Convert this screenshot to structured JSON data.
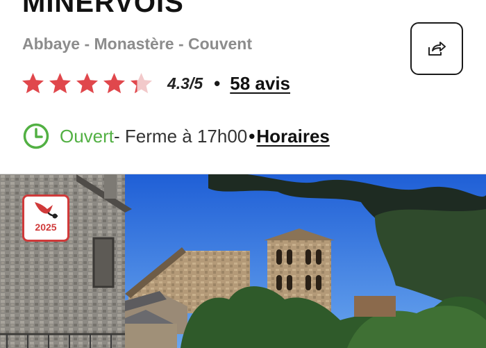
{
  "place": {
    "title": "MINERVOIS",
    "category": "Abbaye - Monastère - Couvent"
  },
  "share": {
    "icon": "share-icon"
  },
  "rating": {
    "stars": 4.3,
    "value_label": "4.3/5",
    "separator": "•",
    "reviews_label": "58 avis",
    "star_color": "#e0474c",
    "star_empty_color": "#f2c9ca"
  },
  "hours": {
    "icon": "clock-icon",
    "status": "Ouvert",
    "closing": " - Ferme à 17h00 ",
    "separator": "•",
    "link_label": "Horaires",
    "status_color": "#52b043"
  },
  "photo": {
    "badge_year": "2025",
    "badge_icon": "award-bird-icon"
  }
}
